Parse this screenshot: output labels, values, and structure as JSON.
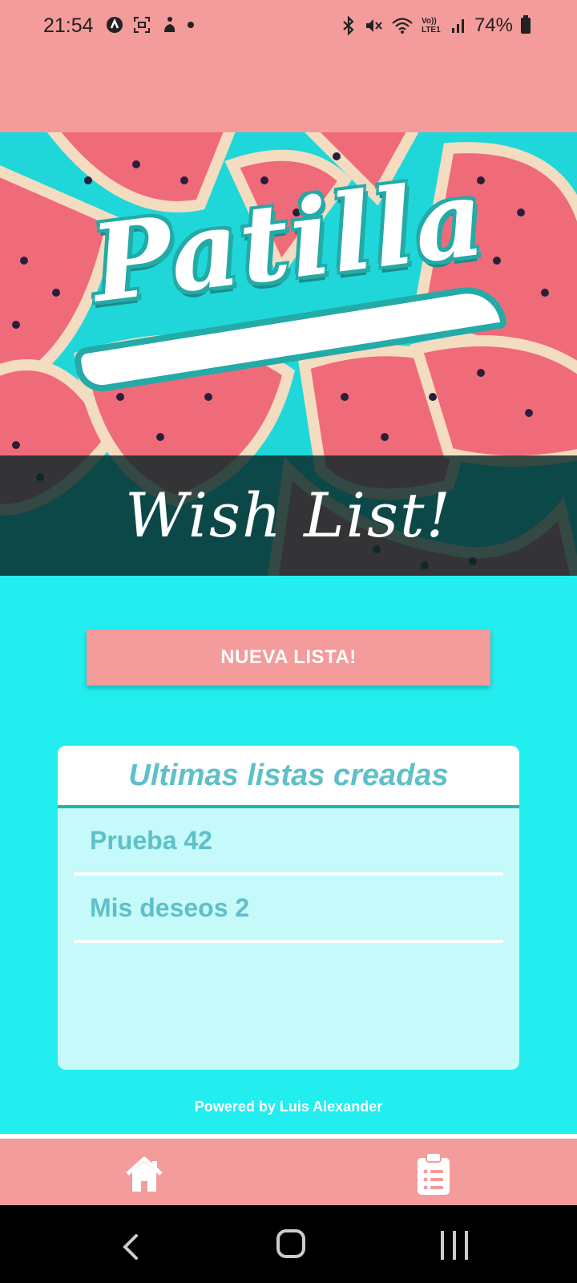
{
  "status_bar": {
    "time": "21:54",
    "battery": "74%",
    "network_label": "Vo)) LTE1"
  },
  "hero": {
    "logo_text": "Patilla",
    "banner_text": "Wish List!"
  },
  "actions": {
    "new_list_label": "NUEVA LISTA!"
  },
  "recent_lists": {
    "title": "Ultimas listas creadas",
    "items": [
      "Prueba 42",
      "Mis deseos 2"
    ]
  },
  "footer": {
    "powered_by": "Powered by Luis Alexander"
  },
  "bottom_nav": {
    "items": [
      {
        "icon": "home-icon"
      },
      {
        "icon": "clipboard-list-icon"
      }
    ]
  },
  "colors": {
    "primary_pink": "#f49b9b",
    "background_cyan": "#22eef0",
    "accent_teal": "#5ec0c8"
  }
}
